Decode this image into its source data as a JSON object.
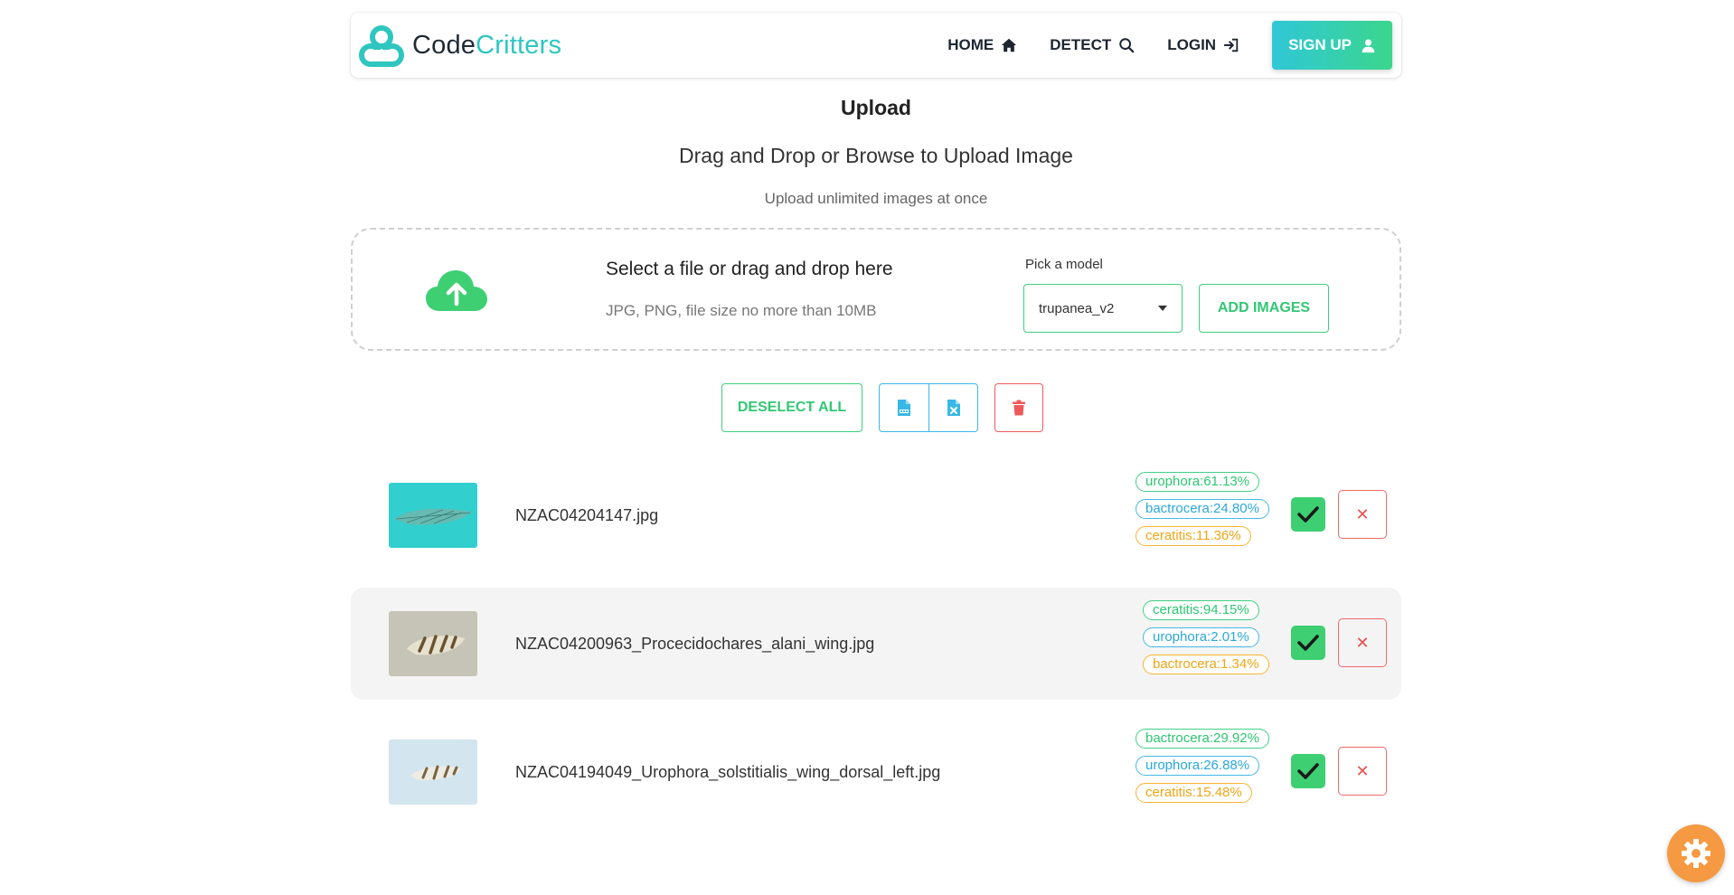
{
  "brand": {
    "part1": "Code",
    "part2": "Critters"
  },
  "nav": {
    "home": "HOME",
    "detect": "DETECT",
    "login": "LOGIN",
    "signup": "SIGN UP"
  },
  "header": {
    "title": "Upload",
    "subtitle": "Drag and Drop or Browse to Upload Image",
    "hint": "Upload unlimited images at once"
  },
  "dropzone": {
    "main": "Select a file or drag and drop here",
    "sub": "JPG, PNG, file size no more than 10MB",
    "model_label": "Pick a model",
    "model_selected": "trupanea_v2",
    "add_images": "ADD IMAGES"
  },
  "toolbar": {
    "deselect_all": "DESELECT ALL"
  },
  "files": [
    {
      "name": "NZAC04204147.jpg",
      "predictions": [
        "urophora:61.13%",
        "bactrocera:24.80%",
        "ceratitis:11.36%"
      ]
    },
    {
      "name": "NZAC04200963_Procecidochares_alani_wing.jpg",
      "predictions": [
        "ceratitis:94.15%",
        "urophora:2.01%",
        "bactrocera:1.34%"
      ]
    },
    {
      "name": "NZAC04194049_Urophora_solstitialis_wing_dorsal_left.jpg",
      "predictions": [
        "bactrocera:29.92%",
        "urophora:26.88%",
        "ceratitis:15.48%"
      ]
    }
  ],
  "remove_symbol": "✕",
  "colors": {
    "brand_teal": "#2fc6c0",
    "accent_green": "#3ecf7c",
    "accent_blue": "#39b8e6",
    "danger_red": "#ee5a5a",
    "fab_orange": "#f59a42"
  }
}
